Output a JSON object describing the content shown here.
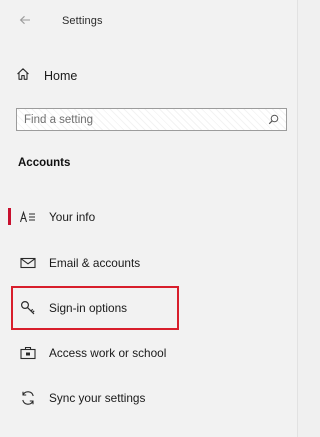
{
  "window": {
    "title": "Settings",
    "back_glyph": "←"
  },
  "home": {
    "label": "Home",
    "icon": "home-icon"
  },
  "search": {
    "placeholder": "Find a setting",
    "value": "",
    "icon": "search-icon"
  },
  "section": {
    "heading": "Accounts"
  },
  "nav": {
    "items": [
      {
        "label": "Your info",
        "icon": "person-info-icon",
        "selected": true
      },
      {
        "label": "Email & accounts",
        "icon": "mail-icon",
        "selected": false
      },
      {
        "label": "Sign-in options",
        "icon": "key-icon",
        "selected": false,
        "highlighted": true
      },
      {
        "label": "Access work or school",
        "icon": "briefcase-icon",
        "selected": false
      },
      {
        "label": "Sync your settings",
        "icon": "sync-icon",
        "selected": false
      }
    ]
  },
  "colors": {
    "selection_accent": "#c8102e",
    "highlight_box": "#d81e2c",
    "background": "#f2f2f2"
  }
}
